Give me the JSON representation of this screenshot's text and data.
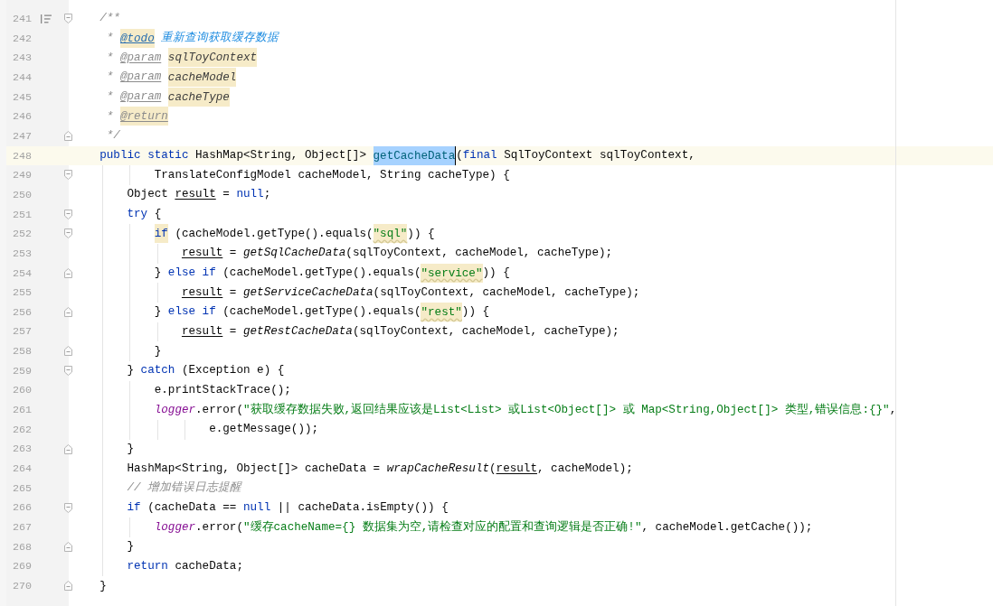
{
  "editor": {
    "lines": [
      {
        "number": "241",
        "current": false,
        "kind": "doc_fold_start",
        "tokens": [
          {
            "text": "    /**",
            "kind": "doc"
          }
        ]
      },
      {
        "number": "242",
        "current": false,
        "kind": "plain",
        "tokens": [
          {
            "text": "     * ",
            "kind": "doc"
          },
          {
            "text": "@todo",
            "kind": "todo_tag"
          },
          {
            "text": " 重新查询获取缓存数据",
            "kind": "todo"
          }
        ]
      },
      {
        "number": "243",
        "current": false,
        "kind": "plain",
        "tokens": [
          {
            "text": "     * ",
            "kind": "doc"
          },
          {
            "text": "@param",
            "kind": "doc_tag"
          },
          {
            "text": " sqlToyContext",
            "kind": "flagged_param"
          }
        ]
      },
      {
        "number": "244",
        "current": false,
        "kind": "plain",
        "tokens": [
          {
            "text": "     * ",
            "kind": "doc"
          },
          {
            "text": "@param",
            "kind": "doc_tag"
          },
          {
            "text": " cacheModel",
            "kind": "flagged_param"
          }
        ]
      },
      {
        "number": "245",
        "current": false,
        "kind": "plain",
        "tokens": [
          {
            "text": "     * ",
            "kind": "doc"
          },
          {
            "text": "@param",
            "kind": "doc_tag"
          },
          {
            "text": " cacheType",
            "kind": "flagged_param"
          }
        ]
      },
      {
        "number": "246",
        "current": false,
        "kind": "plain",
        "tokens": [
          {
            "text": "     * ",
            "kind": "doc"
          },
          {
            "text": "@return",
            "kind": "flagged_doc_tag"
          }
        ]
      },
      {
        "number": "247",
        "current": false,
        "kind": "fold_end",
        "tokens": [
          {
            "text": "     */",
            "kind": "doc"
          }
        ]
      },
      {
        "number": "248",
        "current": true,
        "kind": "plain",
        "tokens": [
          {
            "text": "    public static ",
            "kind": "keyword"
          },
          {
            "text": "HashMap<String, Object[]> ",
            "kind": "plain"
          },
          {
            "text": "getCacheData",
            "kind": "selected"
          },
          {
            "text": "(",
            "kind": "plain"
          },
          {
            "text": "final ",
            "kind": "keyword"
          },
          {
            "text": "SqlToyContext sqlToyContext,",
            "kind": "plain"
          }
        ]
      },
      {
        "number": "249",
        "current": false,
        "kind": "fold_start",
        "tokens": [
          {
            "text": "            TranslateConfigModel cacheModel, String cacheType) {",
            "kind": "plain"
          }
        ]
      },
      {
        "number": "250",
        "current": false,
        "kind": "plain",
        "tokens": [
          {
            "text": "        Object ",
            "kind": "plain"
          },
          {
            "text": "result",
            "kind": "reassigned"
          },
          {
            "text": " = ",
            "kind": "plain"
          },
          {
            "text": "null",
            "kind": "keyword"
          },
          {
            "text": ";",
            "kind": "plain"
          }
        ]
      },
      {
        "number": "251",
        "current": false,
        "kind": "fold_start",
        "tokens": [
          {
            "text": "        try",
            "kind": "keyword"
          },
          {
            "text": " {",
            "kind": "plain"
          }
        ]
      },
      {
        "number": "252",
        "current": false,
        "kind": "fold_start",
        "tokens": [
          {
            "text": "            if",
            "kind": "flagged_keyword"
          },
          {
            "text": " (cacheModel.getType().equals(",
            "kind": "plain"
          },
          {
            "text": "\"sql\"",
            "kind": "flagged_string"
          },
          {
            "text": ")) {",
            "kind": "plain"
          }
        ]
      },
      {
        "number": "253",
        "current": false,
        "kind": "plain",
        "tokens": [
          {
            "text": "                result",
            "kind": "reassigned"
          },
          {
            "text": " = ",
            "kind": "plain"
          },
          {
            "text": "getSqlCacheData",
            "kind": "static_call"
          },
          {
            "text": "(sqlToyContext, cacheModel, cacheType);",
            "kind": "plain"
          }
        ]
      },
      {
        "number": "254",
        "current": false,
        "kind": "fold_end",
        "tokens": [
          {
            "text": "            } ",
            "kind": "plain"
          },
          {
            "text": "else if",
            "kind": "keyword"
          },
          {
            "text": " (cacheModel.getType().equals(",
            "kind": "plain"
          },
          {
            "text": "\"service\"",
            "kind": "flagged_string"
          },
          {
            "text": ")) {",
            "kind": "plain"
          }
        ]
      },
      {
        "number": "255",
        "current": false,
        "kind": "plain",
        "tokens": [
          {
            "text": "                result",
            "kind": "reassigned"
          },
          {
            "text": " = ",
            "kind": "plain"
          },
          {
            "text": "getServiceCacheData",
            "kind": "static_call"
          },
          {
            "text": "(sqlToyContext, cacheModel, cacheType);",
            "kind": "plain"
          }
        ]
      },
      {
        "number": "256",
        "current": false,
        "kind": "fold_end",
        "tokens": [
          {
            "text": "            } ",
            "kind": "plain"
          },
          {
            "text": "else if",
            "kind": "keyword"
          },
          {
            "text": " (cacheModel.getType().equals(",
            "kind": "plain"
          },
          {
            "text": "\"rest\"",
            "kind": "flagged_string"
          },
          {
            "text": ")) {",
            "kind": "plain"
          }
        ]
      },
      {
        "number": "257",
        "current": false,
        "kind": "plain",
        "tokens": [
          {
            "text": "                result",
            "kind": "reassigned"
          },
          {
            "text": " = ",
            "kind": "plain"
          },
          {
            "text": "getRestCacheData",
            "kind": "static_call"
          },
          {
            "text": "(sqlToyContext, cacheModel, cacheType);",
            "kind": "plain"
          }
        ]
      },
      {
        "number": "258",
        "current": false,
        "kind": "fold_end",
        "tokens": [
          {
            "text": "            }",
            "kind": "plain"
          }
        ]
      },
      {
        "number": "259",
        "current": false,
        "kind": "fold_start",
        "tokens": [
          {
            "text": "        } ",
            "kind": "plain"
          },
          {
            "text": "catch",
            "kind": "keyword"
          },
          {
            "text": " (Exception e) {",
            "kind": "plain"
          }
        ]
      },
      {
        "number": "260",
        "current": false,
        "kind": "plain",
        "tokens": [
          {
            "text": "            e.printStackTrace();",
            "kind": "plain"
          }
        ]
      },
      {
        "number": "261",
        "current": false,
        "kind": "plain",
        "tokens": [
          {
            "text": "            logger",
            "kind": "static_field"
          },
          {
            "text": ".error(",
            "kind": "plain"
          },
          {
            "text": "\"获取缓存数据失败,返回结果应该是List<List> 或List<Object[]> 或 Map<String,Object[]> 类型,错误信息:{}\"",
            "kind": "string"
          },
          {
            "text": ",",
            "kind": "plain"
          }
        ]
      },
      {
        "number": "262",
        "current": false,
        "kind": "plain",
        "tokens": [
          {
            "text": "                    e.getMessage());",
            "kind": "plain"
          }
        ]
      },
      {
        "number": "263",
        "current": false,
        "kind": "fold_end",
        "tokens": [
          {
            "text": "        }",
            "kind": "plain"
          }
        ]
      },
      {
        "number": "264",
        "current": false,
        "kind": "plain",
        "tokens": [
          {
            "text": "        HashMap<String, Object[]> cacheData = ",
            "kind": "plain"
          },
          {
            "text": "wrapCacheResult",
            "kind": "static_call"
          },
          {
            "text": "(",
            "kind": "plain"
          },
          {
            "text": "result",
            "kind": "reassigned"
          },
          {
            "text": ", cacheModel);",
            "kind": "plain"
          }
        ]
      },
      {
        "number": "265",
        "current": false,
        "kind": "plain",
        "tokens": [
          {
            "text": "        // 增加错误日志提醒",
            "kind": "comment"
          }
        ]
      },
      {
        "number": "266",
        "current": false,
        "kind": "fold_start",
        "tokens": [
          {
            "text": "        if",
            "kind": "keyword"
          },
          {
            "text": " (cacheData == ",
            "kind": "plain"
          },
          {
            "text": "null",
            "kind": "keyword"
          },
          {
            "text": " || cacheData.isEmpty()) {",
            "kind": "plain"
          }
        ]
      },
      {
        "number": "267",
        "current": false,
        "kind": "plain",
        "tokens": [
          {
            "text": "            logger",
            "kind": "static_field"
          },
          {
            "text": ".error(",
            "kind": "plain"
          },
          {
            "text": "\"缓存cacheName={} 数据集为空,请检查对应的配置和查询逻辑是否正确!\"",
            "kind": "string"
          },
          {
            "text": ", cacheModel.getCache());",
            "kind": "plain"
          }
        ]
      },
      {
        "number": "268",
        "current": false,
        "kind": "fold_end",
        "tokens": [
          {
            "text": "        }",
            "kind": "plain"
          }
        ]
      },
      {
        "number": "269",
        "current": false,
        "kind": "plain",
        "tokens": [
          {
            "text": "        return",
            "kind": "keyword"
          },
          {
            "text": " cacheData;",
            "kind": "plain"
          }
        ]
      },
      {
        "number": "270",
        "current": false,
        "kind": "fold_end",
        "tokens": [
          {
            "text": "    }",
            "kind": "plain"
          }
        ]
      }
    ]
  }
}
